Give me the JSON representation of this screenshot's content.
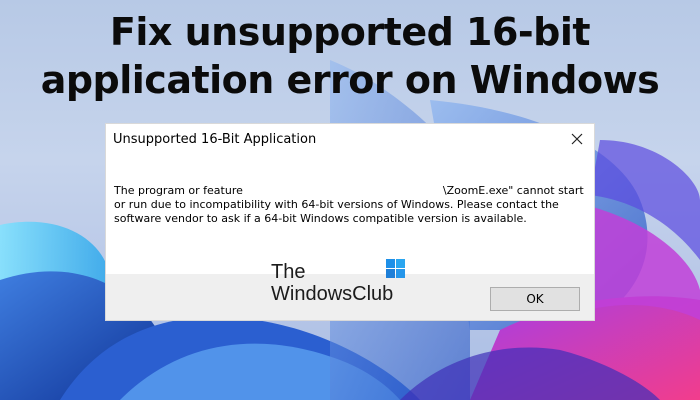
{
  "headline": {
    "line1": "Fix unsupported 16-bit",
    "line2": "application error on Windows"
  },
  "dialog": {
    "title": "Unsupported 16-Bit Application",
    "close_icon": "close-icon",
    "message_part1": "The program or feature",
    "message_part2": "\\ZoomE.exe\" cannot start or run due to incompatibility with 64-bit versions of Windows. Please contact the software vendor to ask if a 64-bit Windows compatible version is available.",
    "ok_label": "OK"
  },
  "watermark": {
    "line1": "The",
    "line2": "WindowsClub",
    "logo_icon": "windows-logo-icon"
  },
  "colors": {
    "dialog_bg": "#ffffff",
    "footer_bg": "#efefef",
    "wallpaper_blue": "#2b6fd6",
    "wallpaper_pink": "#e23aa0"
  }
}
